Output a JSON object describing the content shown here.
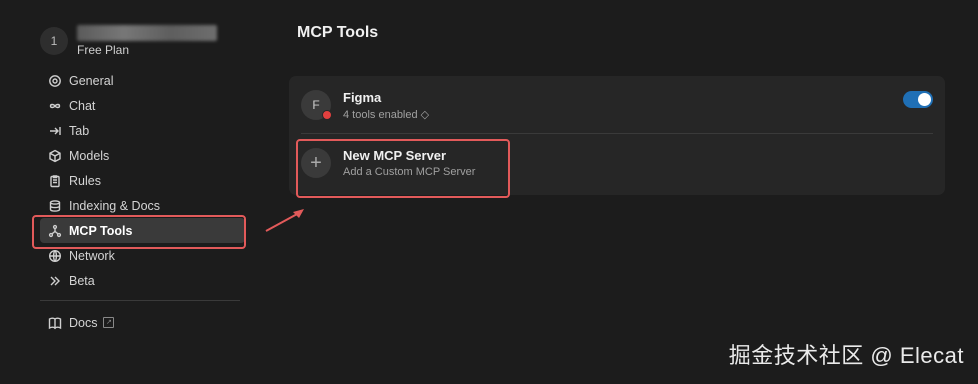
{
  "user": {
    "avatar_initial": "1",
    "plan": "Free Plan"
  },
  "nav": {
    "items": [
      {
        "label": "General",
        "icon": "gear-icon"
      },
      {
        "label": "Chat",
        "icon": "infinity-icon"
      },
      {
        "label": "Tab",
        "icon": "arrow-tab-icon"
      },
      {
        "label": "Models",
        "icon": "cube-icon"
      },
      {
        "label": "Rules",
        "icon": "clipboard-icon"
      },
      {
        "label": "Indexing & Docs",
        "icon": "database-icon"
      },
      {
        "label": "MCP Tools",
        "icon": "nodes-icon",
        "active": true
      },
      {
        "label": "Network",
        "icon": "globe-icon"
      },
      {
        "label": "Beta",
        "icon": "double-chevron-icon"
      }
    ],
    "docs_label": "Docs"
  },
  "main": {
    "title": "MCP Tools",
    "servers": [
      {
        "initial": "F",
        "name": "Figma",
        "subtitle": "4 tools enabled ◇",
        "enabled": true,
        "status_color": "#e2403f"
      }
    ],
    "new_server": {
      "title": "New MCP Server",
      "subtitle": "Add a Custom MCP Server",
      "plus": "+"
    }
  },
  "watermark": "掘金技术社区 @ Elecat",
  "colors": {
    "accent_toggle": "#1f6fb5",
    "highlight": "#e25a5a"
  }
}
